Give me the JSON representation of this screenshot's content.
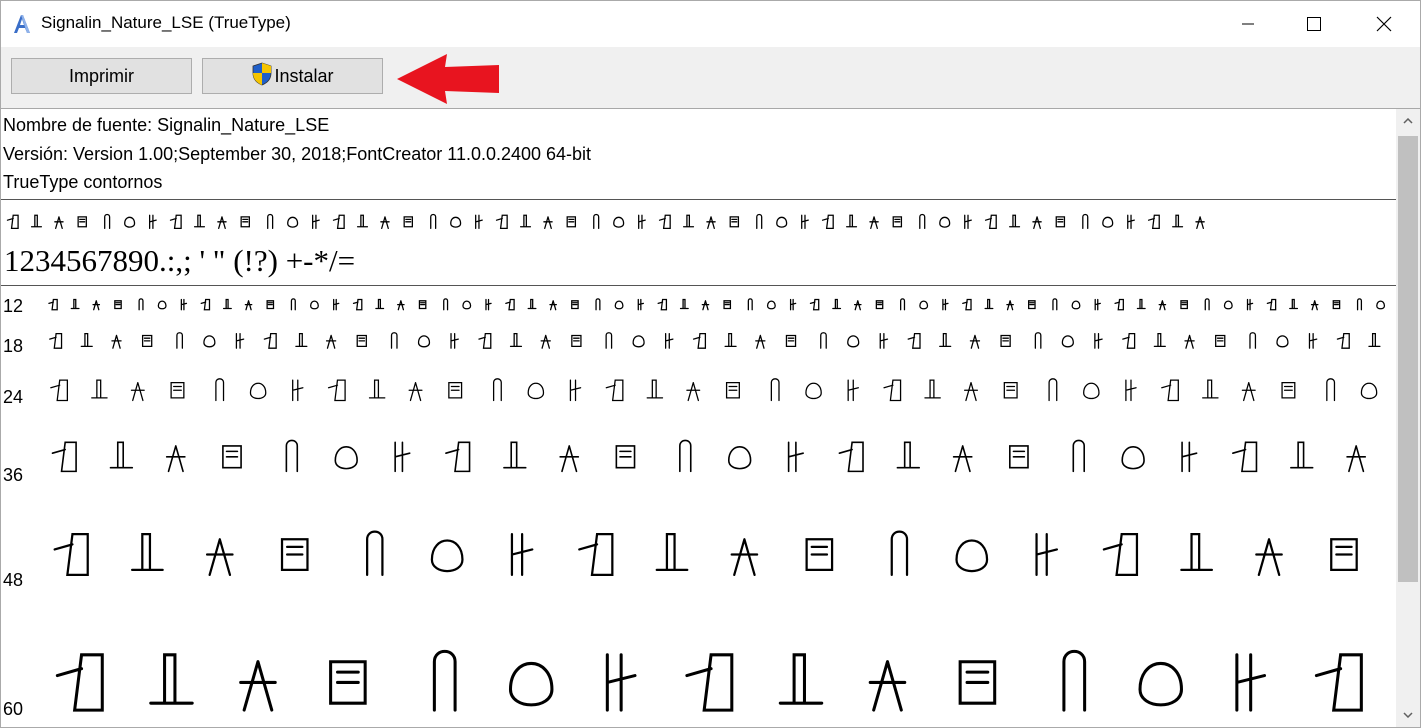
{
  "window": {
    "title": "Signalin_Nature_LSE (TrueType)"
  },
  "toolbar": {
    "print_label": "Imprimir",
    "install_label": "Instalar"
  },
  "info": {
    "font_name": "Nombre de fuente: Signalin_Nature_LSE",
    "version": "Versión: Version 1.00;September 30, 2018;FontCreator 11.0.0.2400 64-bit",
    "outline": "TrueType  contornos"
  },
  "sample": {
    "text": "1234567890.:,; ' \" (!?) +-*/="
  },
  "sizes": [
    {
      "label": "12",
      "glyph_count": 62
    },
    {
      "label": "18",
      "glyph_count": 44
    },
    {
      "label": "24",
      "glyph_count": 34
    },
    {
      "label": "36",
      "glyph_count": 24
    },
    {
      "label": "48",
      "glyph_count": 18
    },
    {
      "label": "60",
      "glyph_count": 15
    }
  ],
  "icons": {
    "app": "font-viewer-icon",
    "shield": "uac-shield-icon",
    "minimize": "minimize-icon",
    "maximize": "maximize-icon",
    "close": "close-icon",
    "annotation": "red-arrow-icon"
  },
  "colors": {
    "arrow": "#e8141f",
    "toolbar": "#f0f0f0",
    "button": "#e1e1e1"
  }
}
